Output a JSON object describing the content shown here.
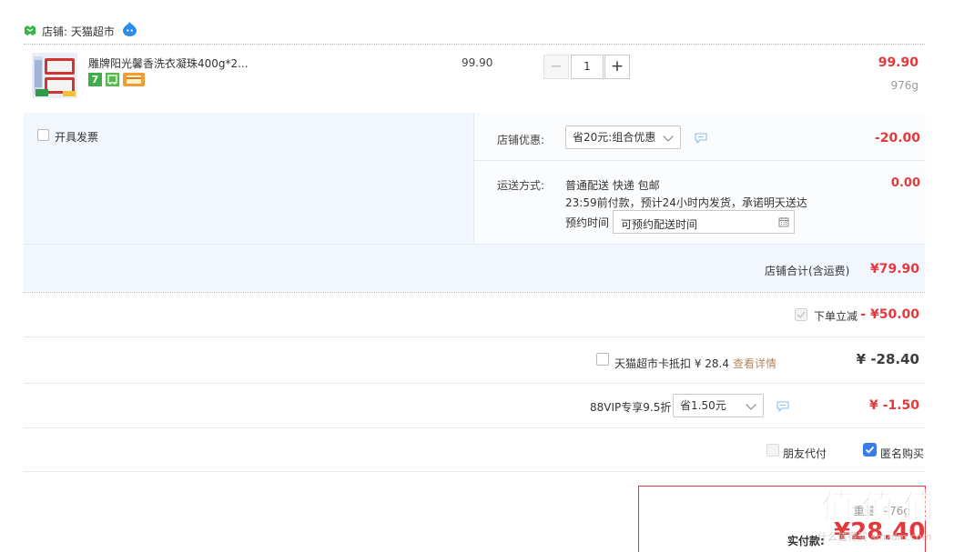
{
  "shop": {
    "label": "店铺: 天猫超市"
  },
  "product": {
    "name": "雕牌阳光馨香洗衣凝珠400g*2...",
    "unit_price": "99.90",
    "quantity": "1",
    "total": "99.90",
    "weight": "976g",
    "qty_minus": "−",
    "qty_plus": "+"
  },
  "invoice": {
    "label": "开具发票"
  },
  "shop_discount": {
    "label": "店铺优惠:",
    "selected": "省20元:组合优惠",
    "amount": "-20.00"
  },
  "delivery": {
    "label": "运送方式:",
    "method": "普通配送 快递 包邮",
    "note": "23:59前付款，预计24小时内发货，承诺明天送达",
    "appointment_label": "预约时间",
    "appointment_placeholder": "可预约配送时间",
    "amount": "0.00"
  },
  "shop_total": {
    "label": "店铺合计(含运费)",
    "amount": "¥79.90"
  },
  "order_discount": {
    "label": "下单立减",
    "amount": "- ¥50.00"
  },
  "card_deduct": {
    "label": "天猫超市卡抵扣 ¥ 28.4",
    "link": "查看详情",
    "amount": "¥ -28.40"
  },
  "vip": {
    "label": "88VIP专享9.5折",
    "selected": "省1.50元",
    "amount": "¥ -1.50"
  },
  "options": {
    "friend_pay": "朋友代付",
    "anonymous": "匿名购买"
  },
  "summary": {
    "weight_partial": "重量: 976g",
    "pay_label": "实付款:",
    "pay_amount": "¥28.40"
  },
  "watermark": {
    "text": "值 值 值",
    "site": "什么值得买 smzdm.com"
  },
  "colors": {
    "accent_red": "#e4393c",
    "panel_bg": "#f2f7ff",
    "link": "#b0875e",
    "check_blue": "#3a7be8"
  }
}
